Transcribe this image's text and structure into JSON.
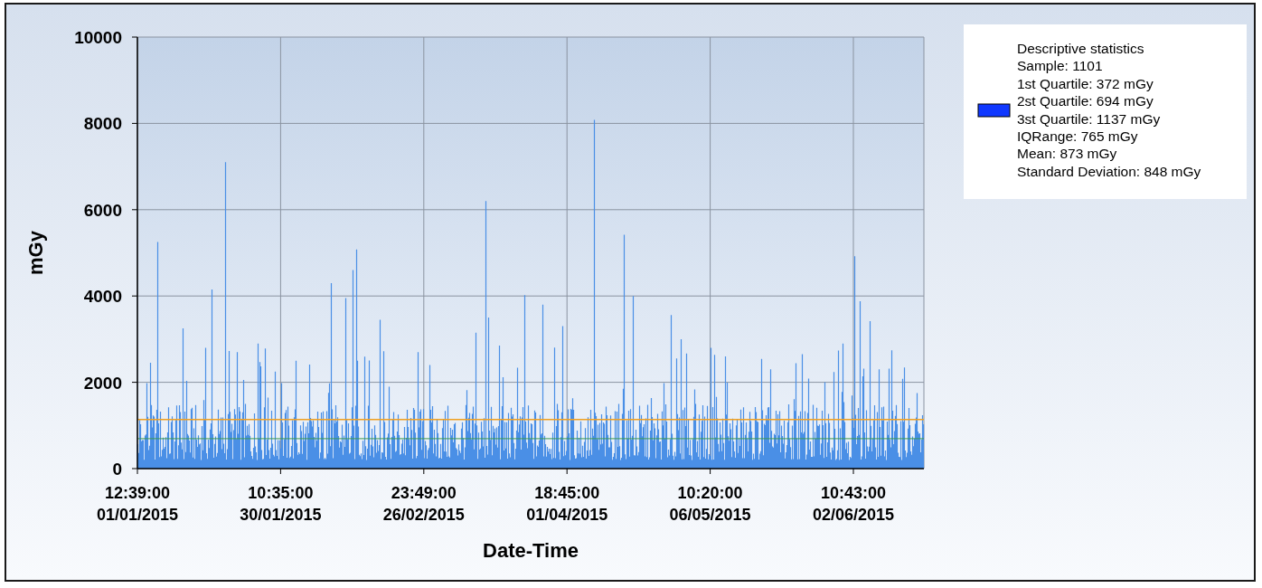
{
  "chart": {
    "ylabel": "mGy",
    "xlabel": "Date-Time",
    "yticks": [
      "10000",
      "8000",
      "6000",
      "4000",
      "2000",
      "0"
    ],
    "xticks": [
      {
        "time": "12:39:00",
        "date": "01/01/2015"
      },
      {
        "time": "10:35:00",
        "date": "30/01/2015"
      },
      {
        "time": "23:49:00",
        "date": "26/02/2015"
      },
      {
        "time": "18:45:00",
        "date": "01/04/2015"
      },
      {
        "time": "10:20:00",
        "date": "06/05/2015"
      },
      {
        "time": "10:43:00",
        "date": "02/06/2015"
      }
    ]
  },
  "legend": {
    "lines": [
      "Descriptive statistics",
      "Sample: 1101",
      "1st Quartile: 372 mGy",
      "2st Quartile: 694 mGy",
      "3st Quartile: 1137 mGy",
      "IQRange: 765 mGy",
      "Mean: 873 mGy",
      "Standard Deviation: 848 mGy"
    ]
  }
}
